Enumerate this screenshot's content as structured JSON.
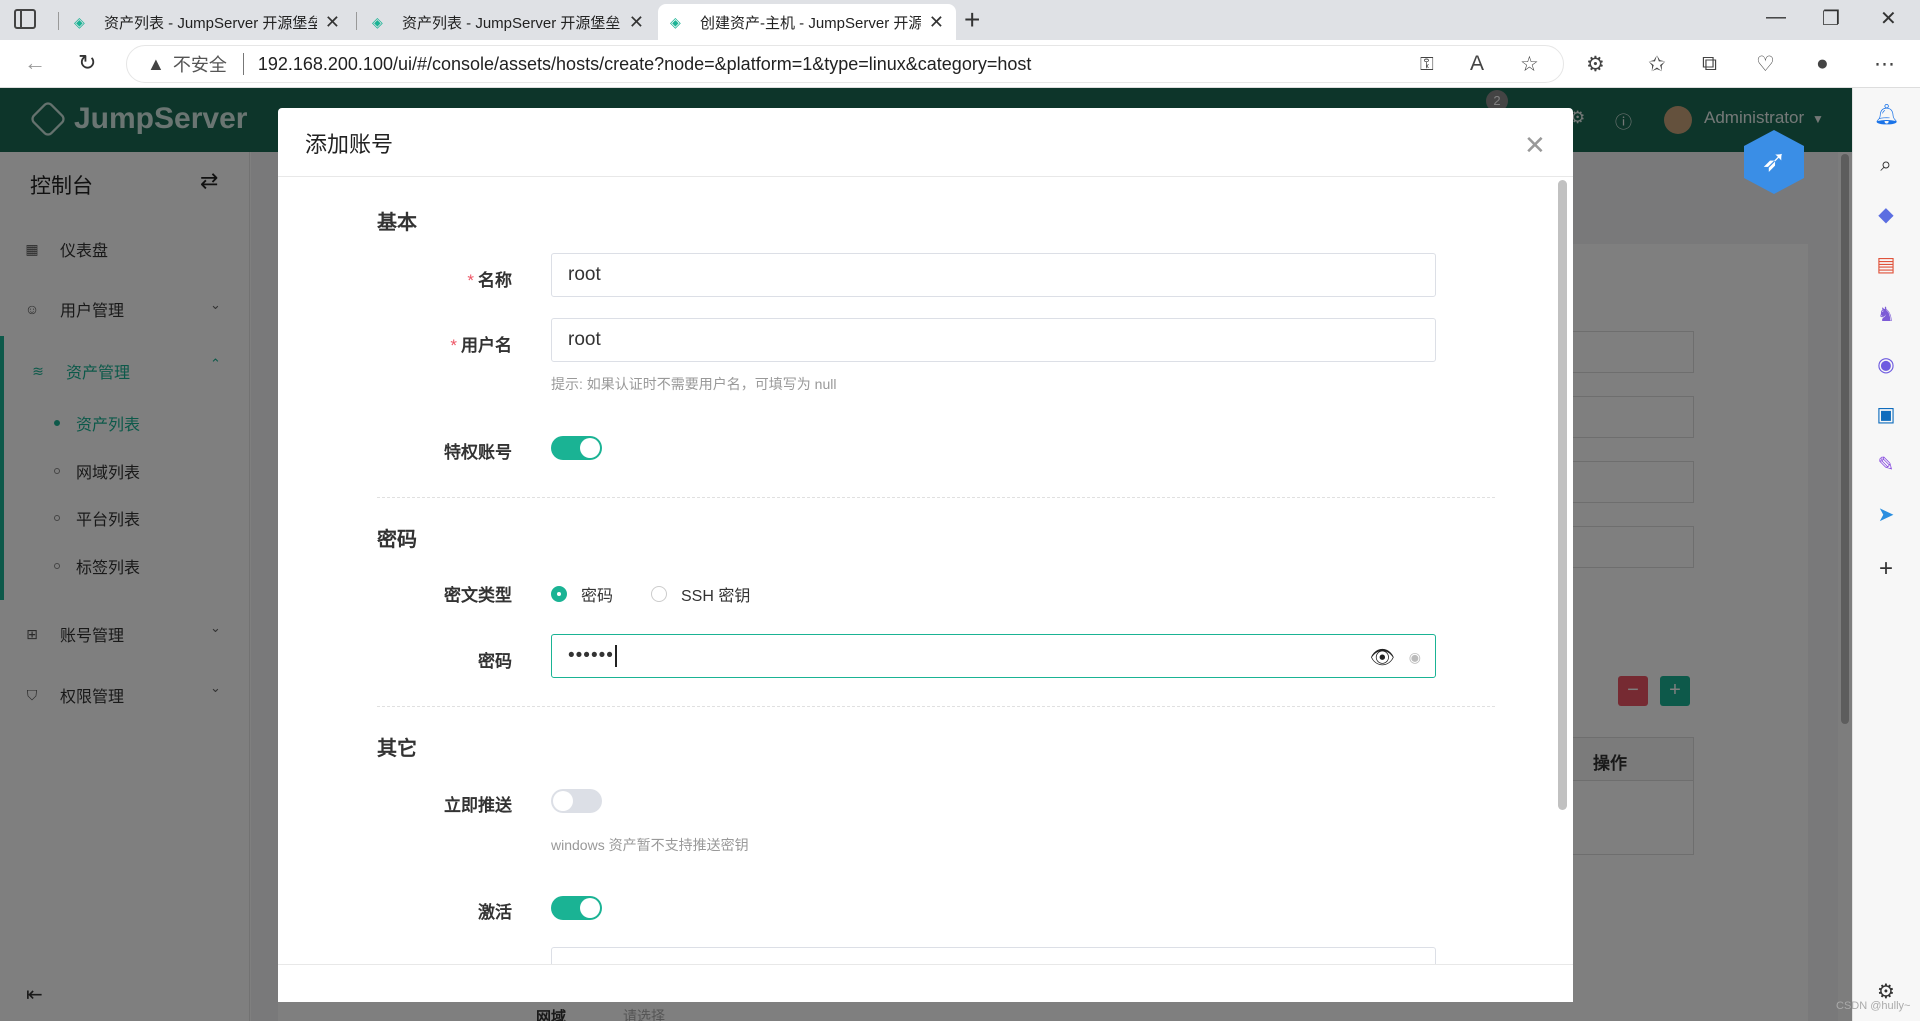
{
  "browser": {
    "tabs": [
      {
        "label": "资产列表 - JumpServer 开源堡垒"
      },
      {
        "label": "资产列表 - JumpServer 开源堡垒"
      },
      {
        "label": "创建资产-主机 - JumpServer 开源"
      }
    ],
    "insecure_label": "不安全",
    "url": "192.168.200.100/ui/#/console/assets/hosts/create?node=&platform=1&type=linux&category=host"
  },
  "app": {
    "brand": "JumpServer",
    "user": "Administrator",
    "notification_count": "2"
  },
  "sidebar": {
    "title": "控制台",
    "items": [
      {
        "label": "仪表盘"
      },
      {
        "label": "用户管理"
      },
      {
        "label": "资产管理"
      },
      {
        "label": "账号管理"
      },
      {
        "label": "权限管理"
      }
    ],
    "subitems": [
      {
        "label": "资产列表"
      },
      {
        "label": "网域列表"
      },
      {
        "label": "平台列表"
      },
      {
        "label": "标签列表"
      }
    ]
  },
  "background": {
    "table_header": "操作",
    "bottom_label": "网域",
    "bottom_placeholder": "请选择"
  },
  "modal": {
    "title": "添加账号",
    "sections": {
      "basic": "基本",
      "password": "密码",
      "other": "其它"
    },
    "fields": {
      "name_label": "名称",
      "name_value": "root",
      "username_label": "用户名",
      "username_value": "root",
      "username_hint": "提示: 如果认证时不需要用户名，可填写为 null",
      "privileged_label": "特权账号",
      "privileged_on": true,
      "secret_type_label": "密文类型",
      "secret_type_options": [
        "密码",
        "SSH 密钥"
      ],
      "secret_type_selected": "密码",
      "password_label": "密码",
      "password_value": "••••••",
      "push_now_label": "立即推送",
      "push_now_on": false,
      "push_hint": "windows 资产暂不支持推送密钥",
      "active_label": "激活",
      "active_on": true
    }
  },
  "watermark": "CSDN @hully~",
  "colors": {
    "accent": "#1ab394",
    "header": "#1b6b55",
    "danger": "#ed5565"
  }
}
